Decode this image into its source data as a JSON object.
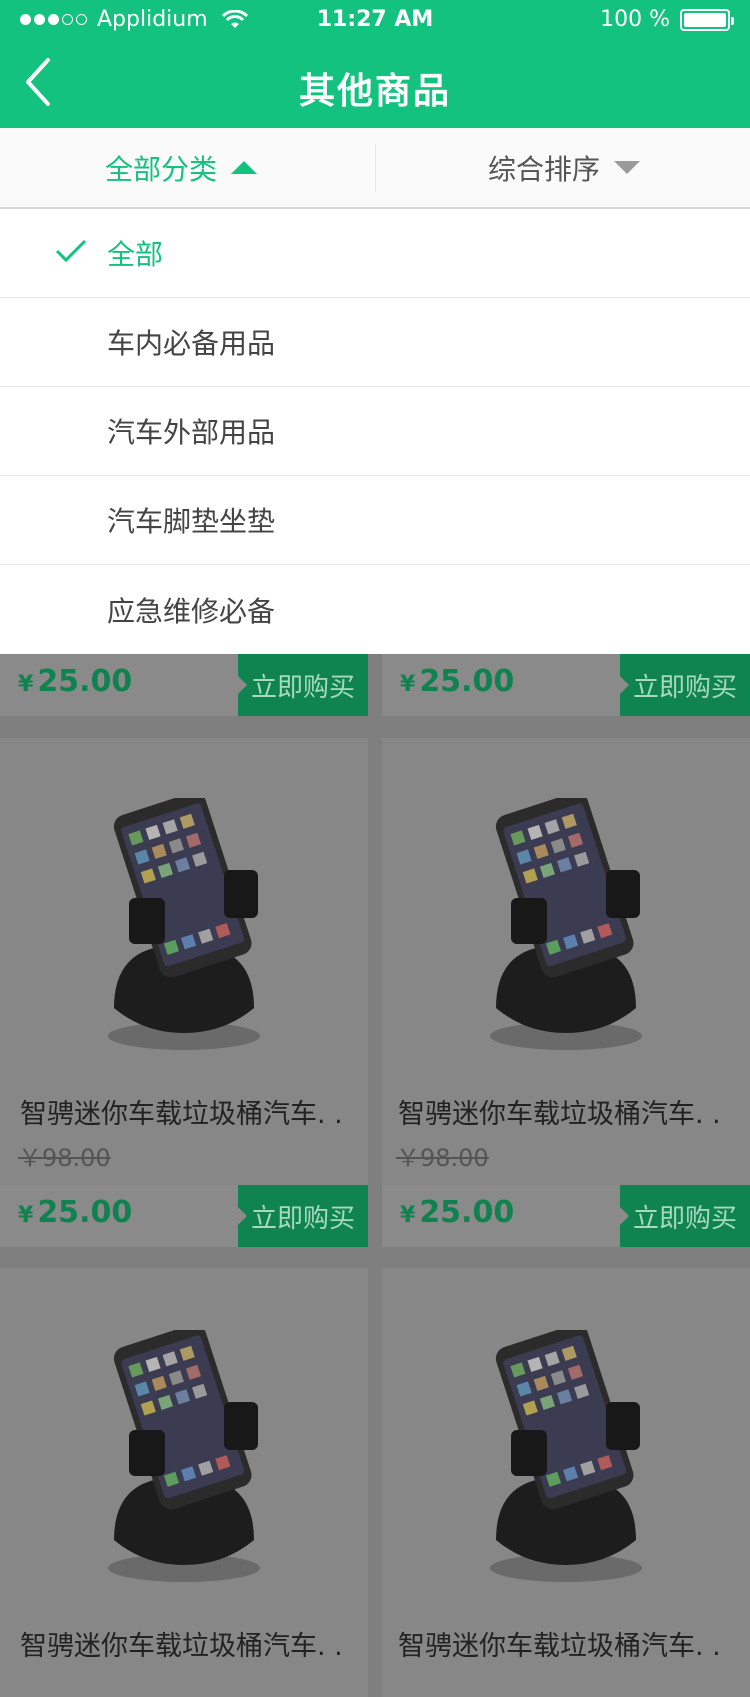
{
  "status_bar": {
    "carrier": "Applidium",
    "time": "11:27 AM",
    "battery": "100 %"
  },
  "nav": {
    "title": "其他商品"
  },
  "filters": {
    "category": "全部分类",
    "sort": "综合排序"
  },
  "dropdown": {
    "items": [
      {
        "label": "全部",
        "selected": true
      },
      {
        "label": "车内必备用品",
        "selected": false
      },
      {
        "label": "汽车外部用品",
        "selected": false
      },
      {
        "label": "汽车脚垫坐垫",
        "selected": false
      },
      {
        "label": "应急维修必备",
        "selected": false
      }
    ]
  },
  "products": {
    "currency": "¥",
    "buy_label": "立即购买",
    "top_row": [
      {
        "price": "25.00"
      },
      {
        "price": "25.00"
      }
    ],
    "row1": [
      {
        "name": "智骋迷你车载垃圾桶汽车. .",
        "original_price": "￥98.00",
        "price": "25.00"
      },
      {
        "name": "智骋迷你车载垃圾桶汽车. .",
        "original_price": "￥98.00",
        "price": "25.00"
      }
    ],
    "row2": [
      {
        "name": "智骋迷你车载垃圾桶汽车. ."
      },
      {
        "name": "智骋迷你车载垃圾桶汽车. ."
      }
    ]
  },
  "colors": {
    "brand": "#13c27e",
    "overlay_price": "#10824f"
  }
}
